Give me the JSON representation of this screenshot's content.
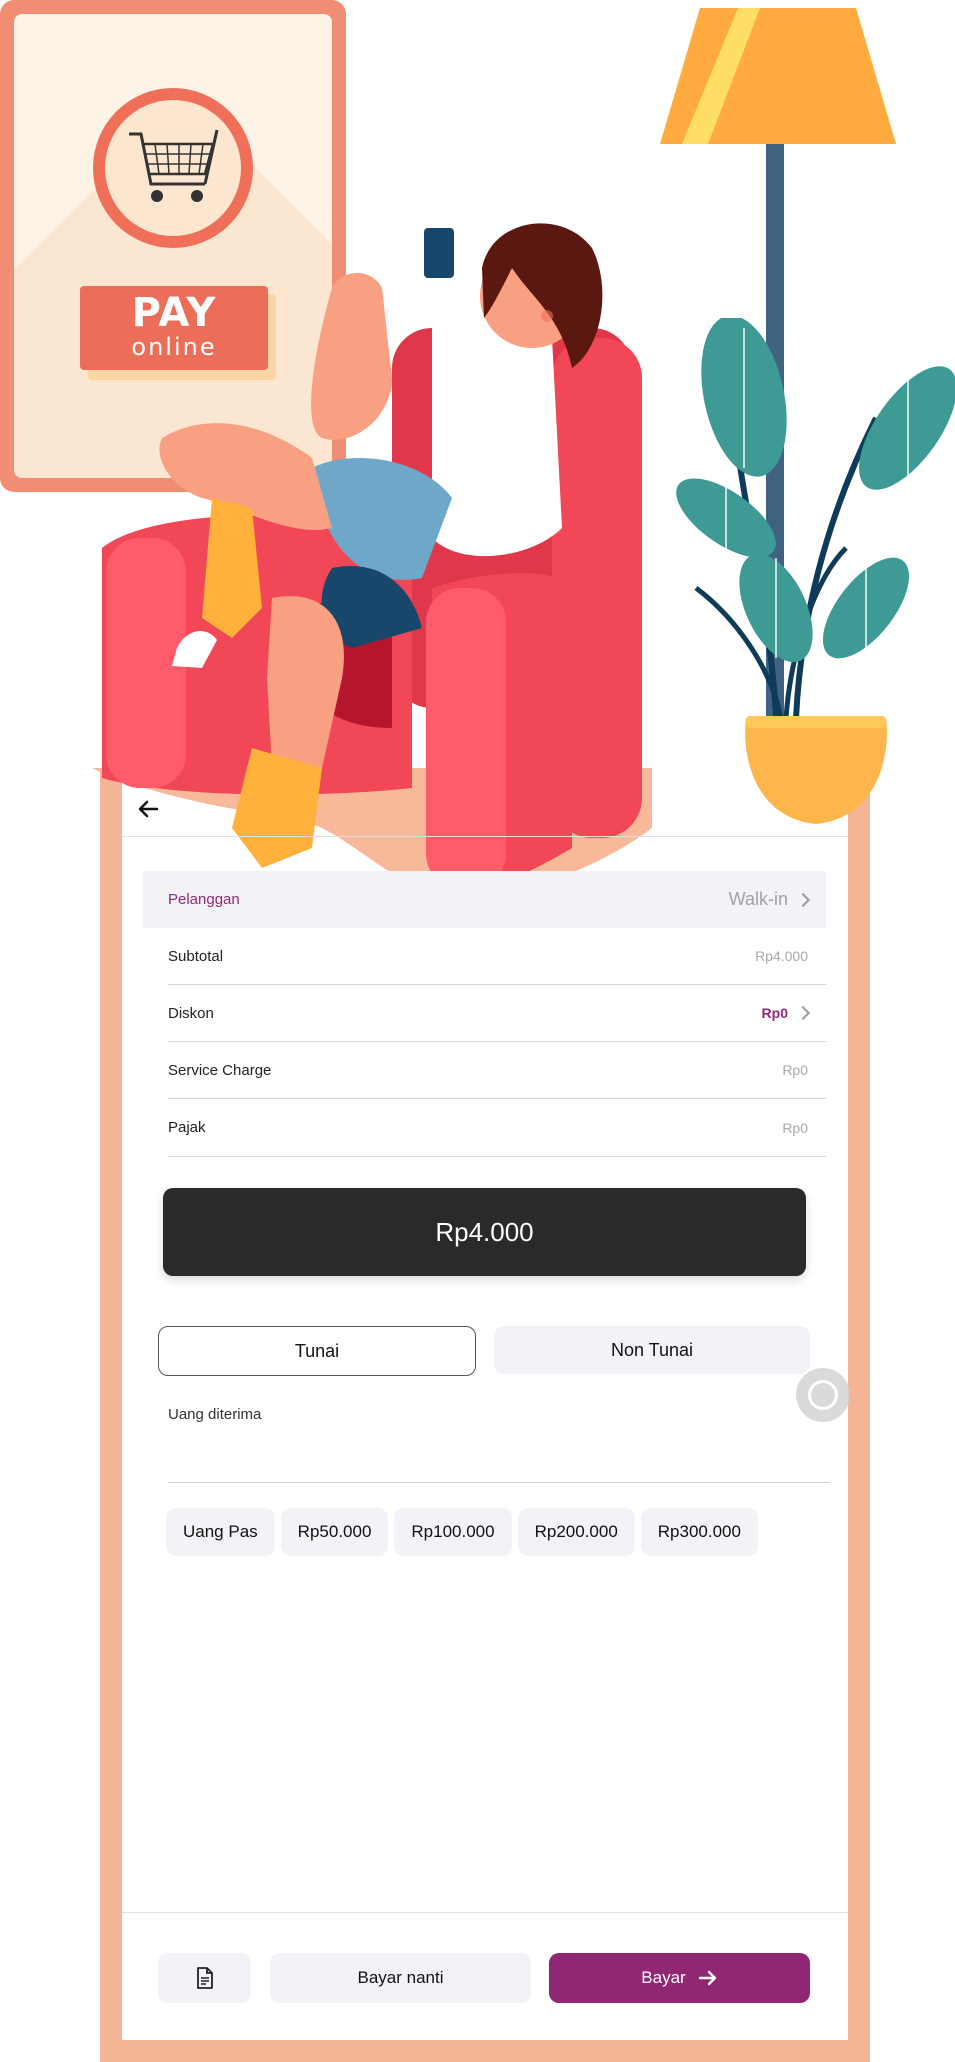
{
  "promo": {
    "pay_word": "PAY",
    "online_word": "online"
  },
  "header": {
    "back_icon": "arrow-left-icon"
  },
  "summary": {
    "customer": {
      "label": "Pelanggan",
      "value": "Walk-in"
    },
    "rows": [
      {
        "label": "Subtotal",
        "value": "Rp4.000"
      },
      {
        "label": "Diskon",
        "value": "Rp0"
      },
      {
        "label": "Service Charge",
        "value": "Rp0"
      },
      {
        "label": "Pajak",
        "value": "Rp0"
      }
    ]
  },
  "total": "Rp4.000",
  "payment_tabs": {
    "cash": "Tunai",
    "non_cash": "Non Tunai",
    "selected": "cash"
  },
  "money_received": {
    "label": "Uang diterima",
    "value": "",
    "placeholder": ""
  },
  "quick_amounts": [
    "Uang Pas",
    "Rp50.000",
    "Rp100.000",
    "Rp200.000",
    "Rp300.000"
  ],
  "footer": {
    "receipt_icon": "document-icon",
    "later_label": "Bayar nanti",
    "pay_label": "Bayar",
    "pay_icon": "arrow-right-icon"
  },
  "colors": {
    "accent": "#912672",
    "accent_text": "#8e2a78",
    "total_bg": "#2a2a2d",
    "frame": "#f3b596"
  }
}
